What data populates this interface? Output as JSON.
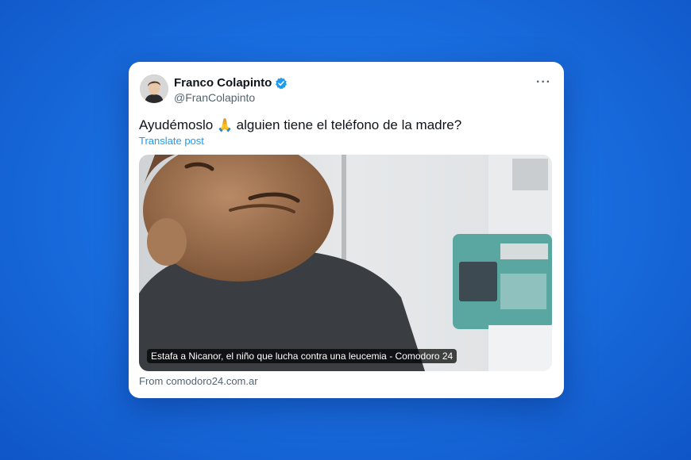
{
  "post": {
    "author_name": "Franco Colapinto",
    "author_handle": "@FranColapinto",
    "text_before": "Ayudémoslo",
    "emoji": "🙏",
    "text_after": "alguien tiene el teléfono de la madre?",
    "translate_label": "Translate post",
    "more_label": "···",
    "link_card": {
      "caption": "Estafa a Nicanor, el niño que lucha contra una leucemia - Comodoro 24",
      "source": "From comodoro24.com.ar"
    }
  },
  "colors": {
    "background": "#1a6fe0",
    "verified": "#1d9bf0",
    "link": "#1d9bf0"
  }
}
